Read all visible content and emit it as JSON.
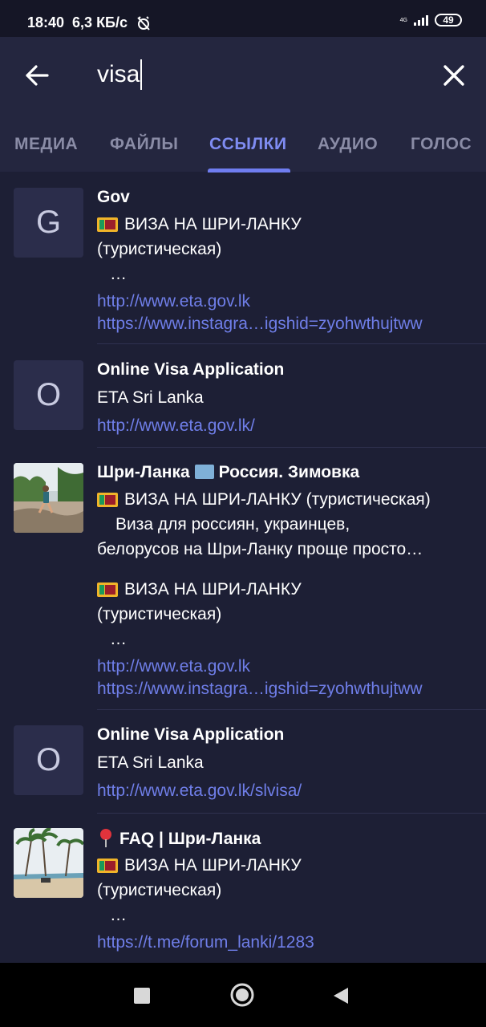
{
  "status": {
    "time": "18:40",
    "speed": "6,3 КБ/с",
    "network": "4G",
    "battery": "49"
  },
  "search": {
    "query": "visa"
  },
  "tabs": [
    {
      "label": "МЕДИА"
    },
    {
      "label": "ФАЙЛЫ"
    },
    {
      "label": "ССЫЛКИ",
      "active": true
    },
    {
      "label": "АУДИО"
    },
    {
      "label": "ГОЛОС"
    }
  ],
  "results": [
    {
      "thumb_letter": "G",
      "title": "Gov",
      "text1": "ВИЗА НА ШРИ-ЛАНКУ",
      "text2": "(туристическая)",
      "ellipsis": "…",
      "link1": "http://www.eta.gov.lk",
      "link2": "https://www.instagra…igshid=zyohwthujtww"
    },
    {
      "thumb_letter": "O",
      "title": "Online Visa Application",
      "text1": "ETA Sri Lanka",
      "link1": "http://www.eta.gov.lk/"
    },
    {
      "thumb_icon": "beach-photo",
      "title_part1": "Шри-Ланка",
      "title_part2": "Россия. Зимовка",
      "text1": "ВИЗА НА ШРИ-ЛАНКУ (туристическая)",
      "text2": "Виза для россиян, украинцев,",
      "text3": "белорусов на Шри-Ланку проще просто…",
      "text4": "ВИЗА НА ШРИ-ЛАНКУ",
      "text5": "(туристическая)",
      "ellipsis": "…",
      "link1": "http://www.eta.gov.lk",
      "link2": "https://www.instagra…igshid=zyohwthujtww"
    },
    {
      "thumb_letter": "O",
      "title": "Online Visa Application",
      "text1": "ETA Sri Lanka",
      "link1": "http://www.eta.gov.lk/slvisa/"
    },
    {
      "thumb_icon": "palm-beach-photo",
      "title": "FAQ | Шри-Ланка",
      "text1": "ВИЗА НА ШРИ-ЛАНКУ",
      "text2": "(туристическая)",
      "ellipsis": "…",
      "link1": "https://t.me/forum_lanki/1283"
    }
  ],
  "colors": {
    "background": "#1d1f35",
    "header": "#24263f",
    "accent": "#7f8cf2",
    "link": "#6f7ee8"
  }
}
